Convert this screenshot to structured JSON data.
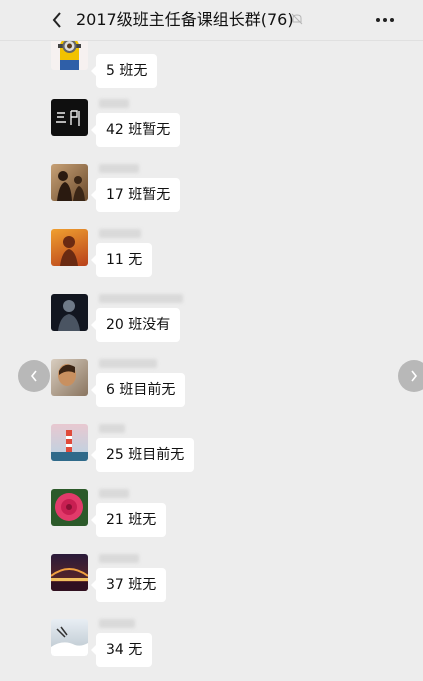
{
  "header": {
    "title": "2017级班主任备课组长群(76)",
    "back_icon": "chevron-left-icon",
    "mute_icon": "bell-muted-icon",
    "more_icon": "ellipsis-icon"
  },
  "messages": [
    {
      "text": "5 班无",
      "avatar": "minion-avatar"
    },
    {
      "text": "42 班暂无",
      "avatar": "calligraphy-avatar"
    },
    {
      "text": "17 班暂无",
      "avatar": "silhouette-avatar"
    },
    {
      "text": "11 无",
      "avatar": "orange-figure-avatar"
    },
    {
      "text": "20 班没有",
      "avatar": "dark-portrait-avatar"
    },
    {
      "text": "6 班目前无",
      "avatar": "profile-avatar"
    },
    {
      "text": "25 班目前无",
      "avatar": "lighthouse-avatar"
    },
    {
      "text": "21 班无",
      "avatar": "flower-avatar"
    },
    {
      "text": "37 班无",
      "avatar": "bridge-night-avatar"
    },
    {
      "text": "34 无",
      "avatar": "snow-scene-avatar"
    }
  ],
  "carousel": {
    "prev_icon": "chevron-left-icon",
    "next_icon": "chevron-right-icon"
  }
}
